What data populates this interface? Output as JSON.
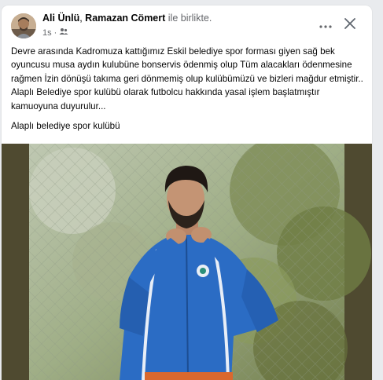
{
  "post": {
    "author_1": "Ali Ünlü",
    "separator": ", ",
    "author_2": "Ramazan Cömert",
    "with_text": " ile birlikte.",
    "time": "1s",
    "dot": "·",
    "audience_icon": "friends-icon",
    "more_icon": "more-horizontal-icon",
    "close_icon": "close-icon",
    "body": "Devre arasında Kadromuza kattığımız Eskil belediye spor forması giyen sağ bek oyuncusu musa aydın kulubüne bonservis ödenmiş olup Tüm alacakları ödenmesine rağmen İzin dönüşü takıma geri dönmemiş olup kulübümüzü ve bizleri mağdur etmiştir..\nAlaplı Belediye spor kulübü olarak futbolcu hakkında yasal işlem başlatmıştır kamuoyuna duyurulur...",
    "signature": "Alaplı belediye spor kulübü"
  },
  "colors": {
    "text": "#050505",
    "secondary": "#65676b",
    "background": "#e9ebee",
    "card": "#ffffff",
    "jersey": "#2b6cc4"
  }
}
